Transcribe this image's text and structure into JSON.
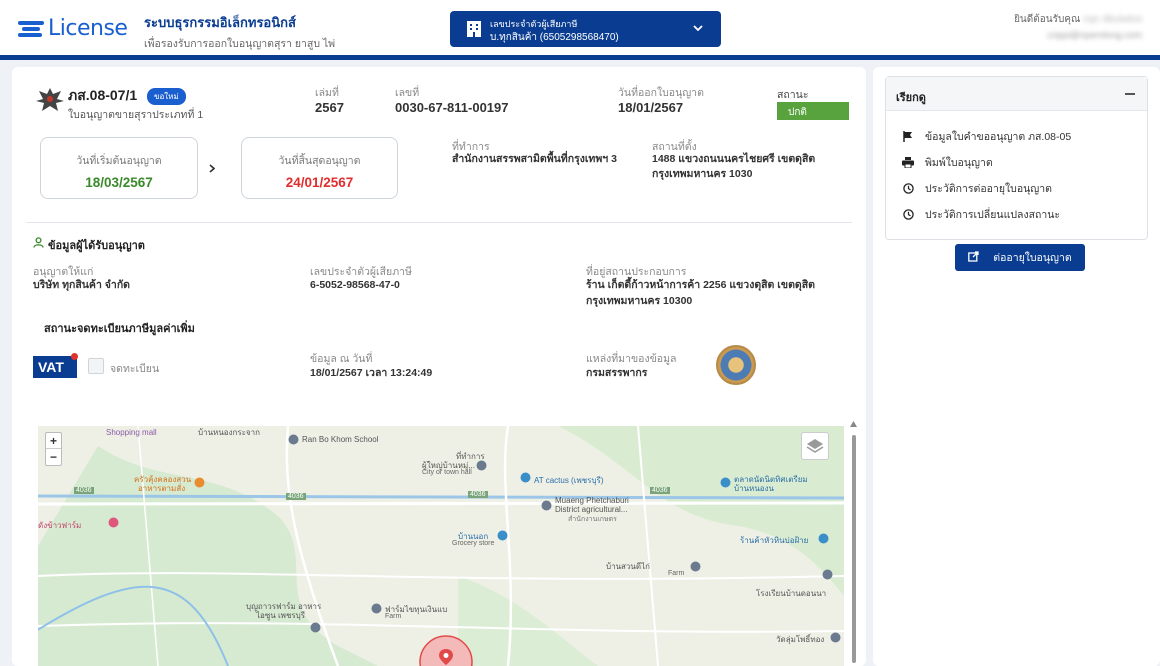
{
  "header": {
    "logo_text": "License",
    "system_title": "ระบบธุรกรรมอิเล็กทรอนิกส์",
    "system_subtitle": "เพื่อรองรับการออกใบอนุญาตสุรา ยาสูบ ไพ่",
    "taxpayer_label": "เลขประจำตัวผู้เสียภาษี",
    "taxpayer_value": "บ.ทุกสินค้า (6505298568470)",
    "welcome_label": "ยินดีต้อนรับคุณ",
    "user_name": "nqn dbulwboi",
    "user_email": "cnppi@npemlong.com"
  },
  "license": {
    "type_code": "ภส.08-07/1",
    "new_badge": "ขอใหม่",
    "type_desc": "ใบอนุญาตขายสุราประเภทที่ 1",
    "book_label": "เล่มที่",
    "book_value": "2567",
    "number_label": "เลขที่",
    "number_value": "0030-67-811-00197",
    "issue_date_label": "วันที่ออกใบอนุญาต",
    "issue_date_value": "18/01/2567",
    "status_label": "สถานะ",
    "status_value": "ปกติ",
    "start_date_label": "วันที่เริ่มต้นอนุญาต",
    "start_date_value": "18/03/2567",
    "end_date_label": "วันที่สิ้นสุดอนุญาต",
    "end_date_value": "24/01/2567",
    "office_label": "ที่ทำการ",
    "office_value": "สำนักงานสรรพสามิตพื้นที่กรุงเทพฯ 3",
    "location_label": "สถานที่ตั้ง",
    "location_line1": "1488 แขวงถนนนครไชยศรี เขตดุสิต",
    "location_line2": "กรุงเทพมหานคร 1030"
  },
  "licensee": {
    "section_title": "ข้อมูลผู้ได้รับอนุญาต",
    "granted_to_label": "อนุญาตให้แก่",
    "granted_to_value": "บริษัท ทุกสินค้า จำกัด",
    "tax_id_label": "เลขประจำตัวผู้เสียภาษี",
    "tax_id_value": "6-5052-98568-47-0",
    "address_label": "ที่อยู่สถานประกอบการ",
    "address_line1": "ร้าน เก็ตดี้ก้าวหน้าการค้า 2256 แขวงดุสิต เขตดุสิต",
    "address_line2": "กรุงเทพมหานคร 10300"
  },
  "vat": {
    "section_title": "สถานะจดทะเบียนภาษีมูลค่าเพิ่ม",
    "logo_text": "VAT",
    "registered_label": "จดทะเบียน",
    "as_of_label": "ข้อมูล ณ วันที่",
    "as_of_value": "18/01/2567 เวลา 13:24:49",
    "source_label": "แหล่งที่มาของข้อมูล",
    "source_value": "กรมสรรพากร"
  },
  "map": {
    "zoom_in": "+",
    "zoom_out": "−",
    "labels": {
      "mall": "Shopping mall",
      "school": "Ran Bo Khom School",
      "school_th": "บ้านหนองกระจาก",
      "townhall_th": "ที่ทำการ",
      "townhall_th2": "ผู้ใหญ่บ้านหมู่...",
      "townhall": "City or town hall",
      "cactus": "AT cactus (เพชรบุรี)",
      "ag_office": "Muaeng Phetchaburi",
      "ag_office2": "District agricultural...",
      "ag_office_th": "สำนักงานเกษตร",
      "restaurant": "ครัวคุ้งคลองสวน",
      "restaurant2": "อาหารตามสั่ง",
      "farm_store": "ดังข้าวฟาร์ม",
      "ban_nok": "บ้านนอก",
      "grocery": "Grocery store",
      "coffee": "ร้านค้าหัวหินบ่อฝ้าย",
      "market": "ตลาดนัดนิตทิศเตรียม",
      "market2": "บ้านหนองน",
      "farm_th": "บ้านสวนดีไก่",
      "farm": "Farm",
      "school2": "โรงเรียนบ้านดอนนา",
      "resort": "บุญถาวรฟาร์ม อาหาร",
      "resort2": "ไอซูน เพชรบุรี",
      "farm2": "ฟาร์มไขทุนเงินแบ",
      "farm2b": "Farm",
      "temple": "วัดลุ่มโพธิ์ทอง",
      "road1": "4036",
      "road2": "4036",
      "road3": "4036",
      "road4": "4036"
    }
  },
  "sidebar": {
    "title": "เรียกดู",
    "items": [
      {
        "label": "ข้อมูลใบคำขออนุญาต ภส.08-05",
        "icon": "flag-icon"
      },
      {
        "label": "พิมพ์ใบอนุญาต",
        "icon": "printer-icon"
      },
      {
        "label": "ประวัติการต่ออายุใบอนุญาต",
        "icon": "clock-icon"
      },
      {
        "label": "ประวัติการเปลี่ยนแปลงสถานะ",
        "icon": "clock-icon"
      }
    ],
    "renew_button": "ต่ออายุใบอนุญาต"
  },
  "colors": {
    "primary": "#0a3d91",
    "status_ok": "#58a33d",
    "start_date": "#3a8a2b",
    "end_date": "#e12d2d"
  }
}
